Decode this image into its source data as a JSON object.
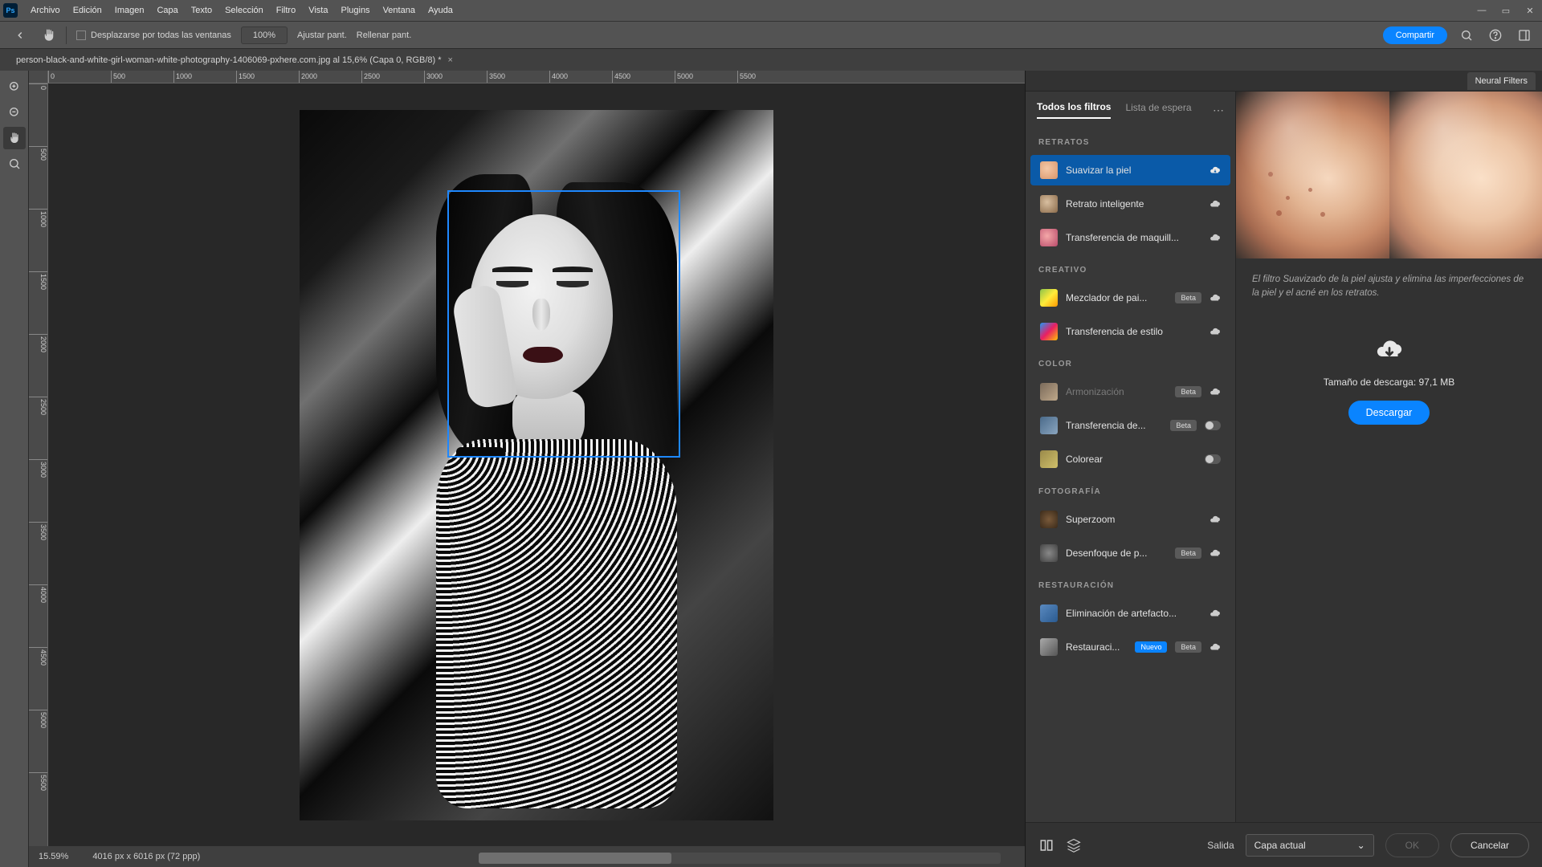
{
  "menu": [
    "Archivo",
    "Edición",
    "Imagen",
    "Capa",
    "Texto",
    "Selección",
    "Filtro",
    "Vista",
    "Plugins",
    "Ventana",
    "Ayuda"
  ],
  "options": {
    "scroll_all": "Desplazarse por todas las ventanas",
    "zoom100": "100%",
    "fit": "Ajustar pant.",
    "fill": "Rellenar pant.",
    "share": "Compartir"
  },
  "tab": {
    "title": "person-black-and-white-girl-woman-white-photography-1406069-pxhere.com.jpg al 15,6% (Capa 0, RGB/8) *"
  },
  "rulers_h": [
    "0",
    "500",
    "1000",
    "1500",
    "2000",
    "2500",
    "3000",
    "3500",
    "4000",
    "4500",
    "5000",
    "5500"
  ],
  "rulers_v": [
    "0",
    "500",
    "1000",
    "1500",
    "2000",
    "2500",
    "3000",
    "3500",
    "4000",
    "4500",
    "5000",
    "5500"
  ],
  "status": {
    "zoom": "15.59%",
    "info": "4016 px x 6016 px (72 ppp)"
  },
  "panel": {
    "title": "Neural Filters",
    "tabs": {
      "all": "Todos los filtros",
      "wait": "Lista de espera"
    },
    "sections": {
      "retratos": "RETRATOS",
      "creativo": "CREATIVO",
      "color": "COLOR",
      "fotografia": "FOTOGRAFÍA",
      "restauracion": "RESTAURACIÓN"
    },
    "filters": {
      "suavizar": "Suavizar la piel",
      "retrato": "Retrato inteligente",
      "maquillaje": "Transferencia de maquill...",
      "paisajes": "Mezclador de pai...",
      "estilo": "Transferencia de estilo",
      "armonizacion": "Armonización",
      "transfer": "Transferencia de...",
      "colorear": "Colorear",
      "superzoom": "Superzoom",
      "desenfoque": "Desenfoque de p...",
      "jpeg": "Eliminación de artefacto...",
      "restauracion": "Restauraci..."
    },
    "badges": {
      "beta": "Beta",
      "nuevo": "Nuevo"
    },
    "detail": {
      "desc": "El filtro Suavizado de la piel ajusta y elimina las imperfecciones de la piel y el acné en los retratos.",
      "size": "Tamaño de descarga: 97,1 MB",
      "download": "Descargar"
    }
  },
  "footer": {
    "output_label": "Salida",
    "output_value": "Capa actual",
    "ok": "OK",
    "cancel": "Cancelar"
  }
}
